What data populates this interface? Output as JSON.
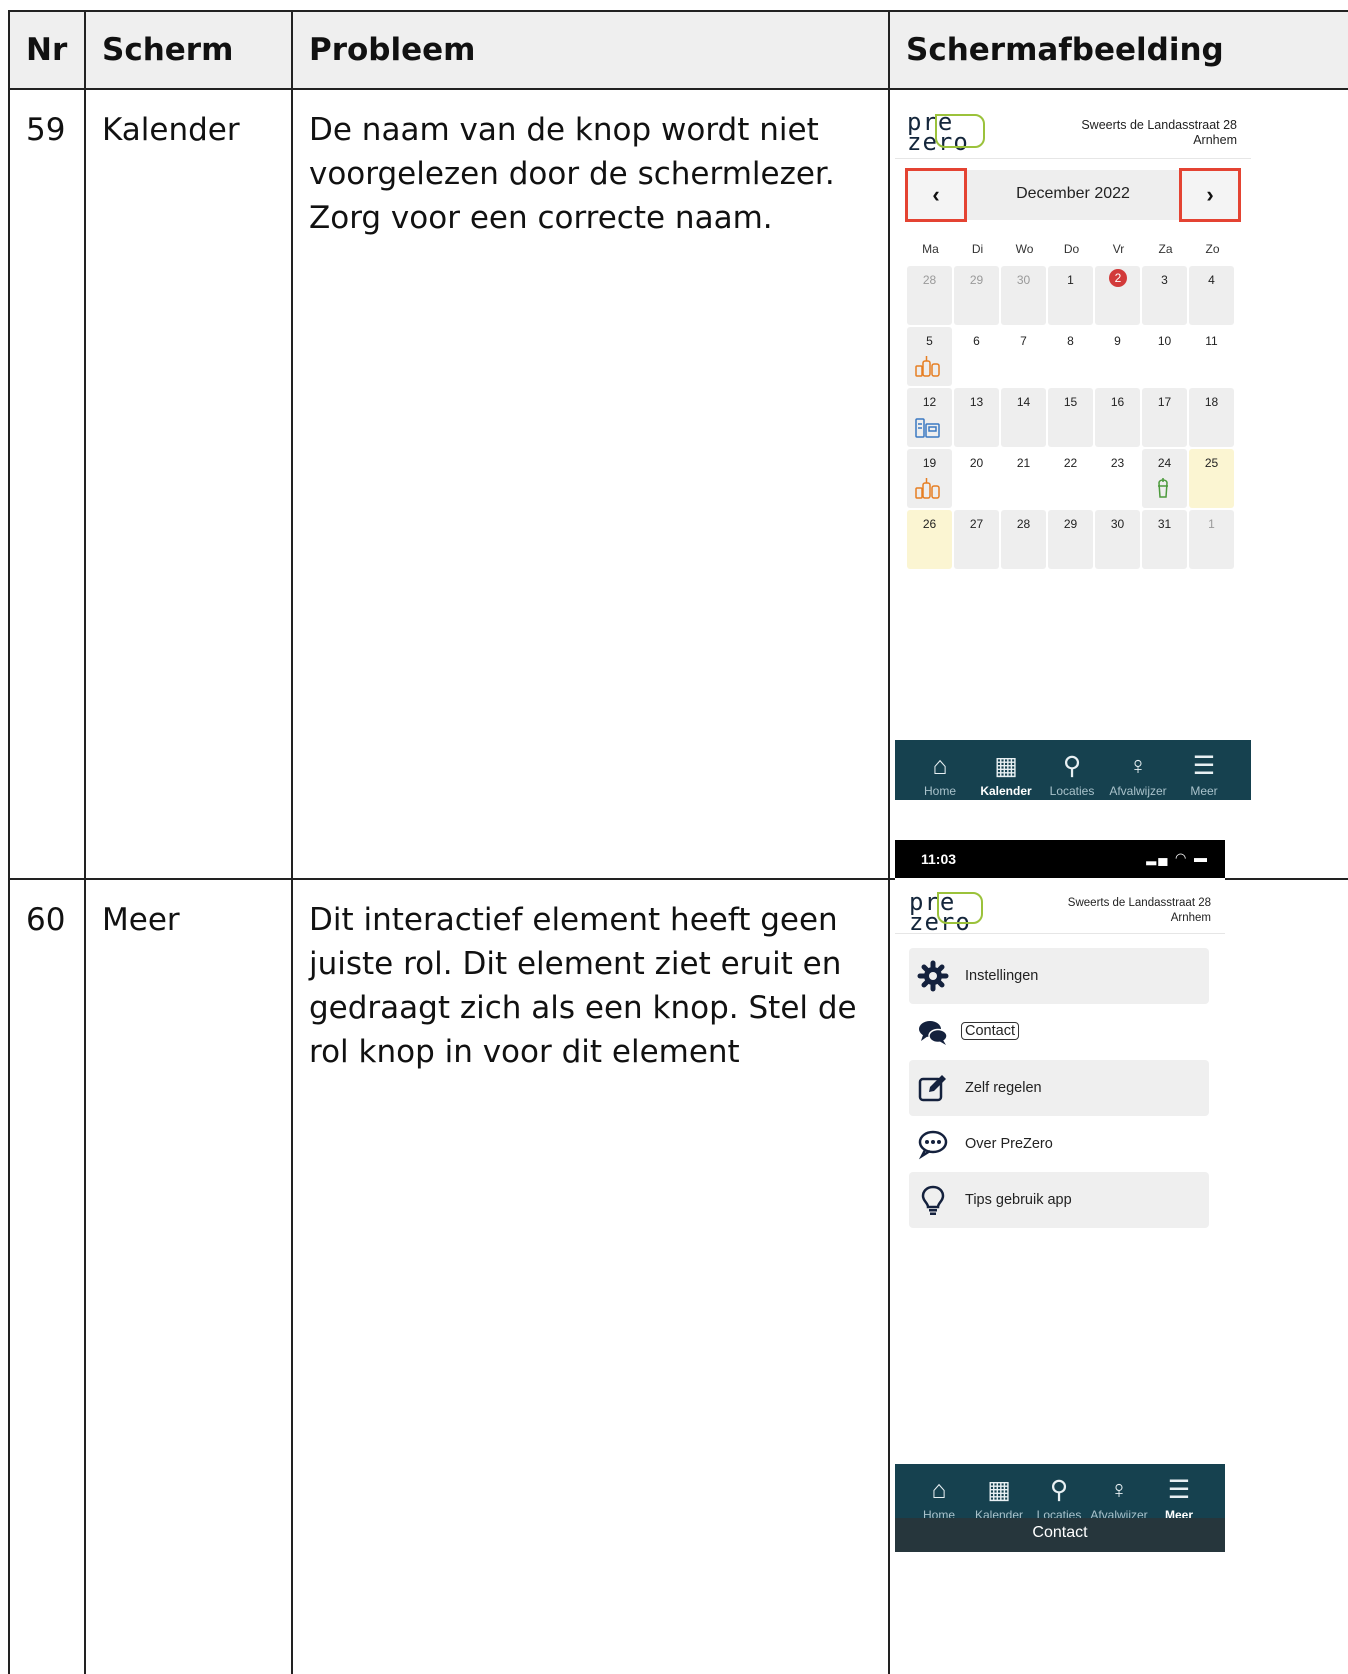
{
  "table": {
    "headers": {
      "nr": "Nr",
      "scherm": "Scherm",
      "probleem": "Probleem",
      "schermafbeelding": "Schermafbeelding"
    },
    "rows": [
      {
        "nr": "59",
        "scherm": "Kalender",
        "probleem": "De naam van de knop wordt niet voorgelezen door de schermlezer. Zorg voor een correcte naam."
      },
      {
        "nr": "60",
        "scherm": "Meer",
        "probleem": "Dit interactief element heeft geen juiste rol. Dit element ziet eruit en gedraagt zich als een knop. Stel de rol knop in voor dit element"
      }
    ]
  },
  "app": {
    "logo": {
      "line1": "pre",
      "line2": "zero"
    },
    "address": {
      "line1": "Sweerts de Landasstraat 28",
      "line2": "Arnhem"
    },
    "tabs": [
      {
        "label": "Home",
        "icon": "home-icon"
      },
      {
        "label": "Kalender",
        "icon": "calendar-icon"
      },
      {
        "label": "Locaties",
        "icon": "map-pin-icon"
      },
      {
        "label": "Afvalwijzer",
        "icon": "lightbulb-icon"
      },
      {
        "label": "Meer",
        "icon": "list-icon"
      }
    ],
    "colors": {
      "tabbar": "#16414f",
      "accent_red": "#d23a3a",
      "highlight": "#e44332",
      "logo_green": "#9bc23b",
      "today_bg": "#fbf5d2"
    }
  },
  "calendar": {
    "month": "December 2022",
    "prev_icon": "chevron-left-icon",
    "next_icon": "chevron-right-icon",
    "weekdays": [
      "Ma",
      "Di",
      "Wo",
      "Do",
      "Vr",
      "Za",
      "Zo"
    ],
    "days": [
      "28",
      "29",
      "30",
      "1",
      "2",
      "3",
      "4",
      "5",
      "6",
      "7",
      "8",
      "9",
      "10",
      "11",
      "12",
      "13",
      "14",
      "15",
      "16",
      "17",
      "18",
      "19",
      "20",
      "21",
      "22",
      "23",
      "24",
      "25",
      "26",
      "27",
      "28",
      "29",
      "30",
      "31",
      "1"
    ],
    "active_tab": "Kalender"
  },
  "meer": {
    "status_time": "11:03",
    "menu": [
      {
        "label": "Instellingen",
        "icon": "gear-icon"
      },
      {
        "label": "Contact",
        "icon": "chat-bubbles-icon"
      },
      {
        "label": "Zelf regelen",
        "icon": "edit-icon"
      },
      {
        "label": "Over PreZero",
        "icon": "comment-dots-icon"
      },
      {
        "label": "Tips gebruik app",
        "icon": "lightbulb-icon"
      }
    ],
    "active_tab": "Meer",
    "toast": "Contact"
  }
}
